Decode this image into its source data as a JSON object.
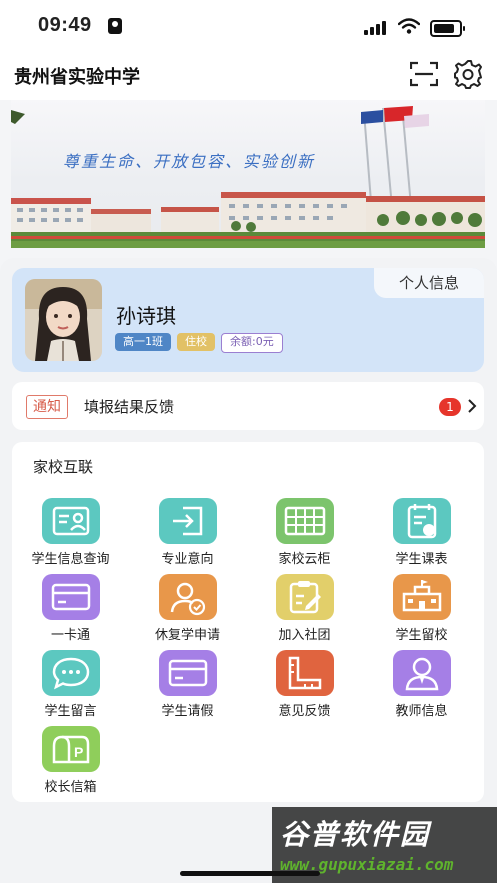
{
  "status_bar": {
    "time": "09:49"
  },
  "header": {
    "title": "贵州省实验中学"
  },
  "banner": {
    "slogan": "尊重生命、开放包容、实验创新"
  },
  "profile": {
    "tab_label": "个人信息",
    "name": "孙诗琪",
    "chips": [
      "高一1班",
      "住校",
      "余额:0元"
    ]
  },
  "notice": {
    "tag": "通知",
    "text": "填报结果反馈",
    "count": "1"
  },
  "section": {
    "title": "家校互联",
    "items": [
      {
        "label": "学生信息查询",
        "icon": "id-card-icon",
        "color": "#5cc8c0"
      },
      {
        "label": "专业意向",
        "icon": "login-icon",
        "color": "#5cc8c0"
      },
      {
        "label": "家校云柜",
        "icon": "cabinet-icon",
        "color": "#7cc46c"
      },
      {
        "label": "学生课表",
        "icon": "schedule-icon",
        "color": "#5cc8c0"
      },
      {
        "label": "一卡通",
        "icon": "card-icon",
        "color": "#a57fe6"
      },
      {
        "label": "休复学申请",
        "icon": "user-check-icon",
        "color": "#e8974a"
      },
      {
        "label": "加入社团",
        "icon": "clipboard-edit-icon",
        "color": "#e2cf6a"
      },
      {
        "label": "学生留校",
        "icon": "school-building-icon",
        "color": "#e8974a"
      },
      {
        "label": "学生留言",
        "icon": "chat-icon",
        "color": "#5cc8c0"
      },
      {
        "label": "学生请假",
        "icon": "card-icon",
        "color": "#a57fe6"
      },
      {
        "label": "意见反馈",
        "icon": "ruler-icon",
        "color": "#e0643f"
      },
      {
        "label": "教师信息",
        "icon": "teacher-icon",
        "color": "#a57fe6"
      },
      {
        "label": "校长信箱",
        "icon": "mailbox-icon",
        "color": "#8fce5b"
      }
    ]
  },
  "watermark": {
    "brand": "谷普软件园",
    "url": "www.gupuxiazai.com"
  }
}
